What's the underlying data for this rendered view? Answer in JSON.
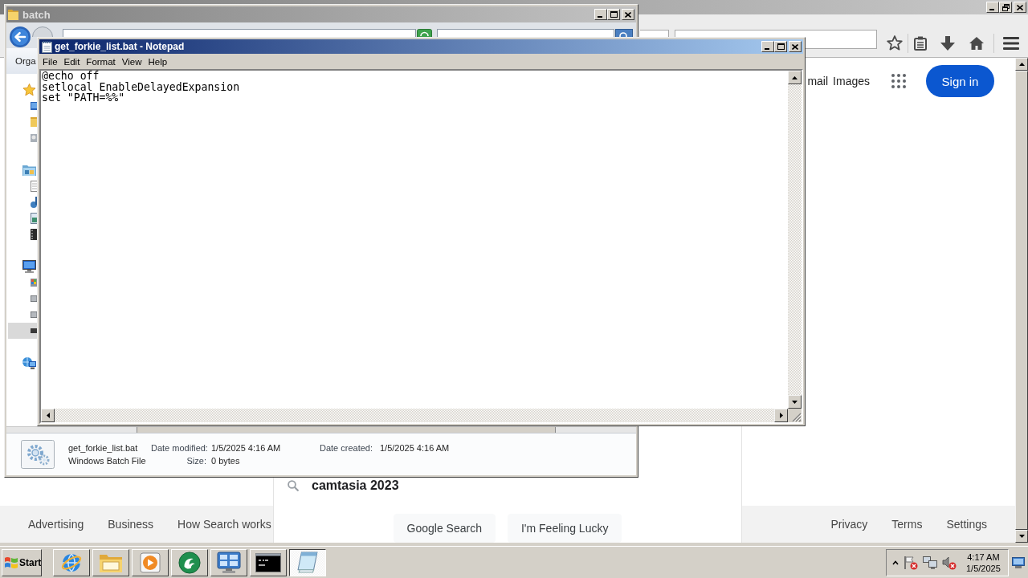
{
  "browser": {
    "header_links": [
      "mail",
      "Images"
    ],
    "sign_in": "Sign in",
    "suggestions": [
      "camtasia 2023"
    ],
    "search_buttons": [
      "Google Search",
      "I'm Feeling Lucky"
    ],
    "footer_left": [
      "Advertising",
      "Business",
      "How Search works"
    ],
    "footer_right": [
      "Privacy",
      "Terms",
      "Settings"
    ]
  },
  "explorer": {
    "title": "batch",
    "toolbar": [
      "Orga"
    ],
    "nav_tree": [
      {
        "selected": false,
        "children": [
          {
            "selected": false
          },
          {
            "selected": false
          },
          {
            "selected": false
          }
        ]
      },
      {
        "selected": false,
        "children": [
          {
            "selected": false
          },
          {
            "selected": false
          },
          {
            "selected": false
          },
          {
            "selected": false
          }
        ]
      },
      {
        "selected": false,
        "children": [
          {
            "selected": false
          },
          {
            "selected": false
          },
          {
            "selected": false
          },
          {
            "selected": true
          }
        ]
      },
      {
        "selected": false
      }
    ],
    "details": [
      {
        "text": "get_forkie_list.bat",
        "fields": [
          {
            "label": "Date modified:",
            "value": "1/5/2025 4:16 AM"
          },
          {
            "label": "Date created:",
            "value": "1/5/2025 4:16 AM"
          }
        ]
      },
      {
        "text": "Windows Batch File",
        "fields": [
          {
            "label": "Size:",
            "value": "0 bytes"
          }
        ]
      }
    ]
  },
  "notepad": {
    "title": "get_forkie_list.bat - Notepad",
    "menu": [
      "File",
      "Edit",
      "Format",
      "View",
      "Help"
    ],
    "lines": [
      "@echo off",
      "setlocal EnableDelayedExpansion",
      "set \"PATH=%%\""
    ]
  },
  "taskbar": {
    "start": "Start",
    "apps": [
      {
        "selected": false
      },
      {
        "selected": false
      },
      {
        "selected": false
      },
      {
        "selected": false
      },
      {
        "selected": false
      },
      {
        "selected": false
      },
      {
        "selected": true
      }
    ],
    "clock": {
      "time": "4:17 AM",
      "date": "1/5/2025"
    }
  }
}
